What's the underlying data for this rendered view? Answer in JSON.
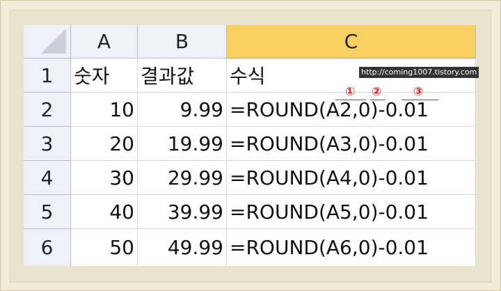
{
  "columns": [
    "A",
    "B",
    "C"
  ],
  "row_numbers": [
    "1",
    "2",
    "3",
    "4",
    "5",
    "6"
  ],
  "rows": [
    {
      "a": "숫자",
      "b": "결과값",
      "c": "수식"
    },
    {
      "a": "10",
      "b": "9.99",
      "c": "=ROUND(A2,0)-0.01"
    },
    {
      "a": "20",
      "b": "19.99",
      "c": "=ROUND(A3,0)-0.01"
    },
    {
      "a": "30",
      "b": "29.99",
      "c": "=ROUND(A4,0)-0.01"
    },
    {
      "a": "40",
      "b": "39.99",
      "c": "=ROUND(A5,0)-0.01"
    },
    {
      "a": "50",
      "b": "49.99",
      "c": "=ROUND(A6,0)-0.01"
    }
  ],
  "watermark": "http://coming1007.tistory.com",
  "annotations": [
    "①",
    "②",
    "③"
  ],
  "colors": {
    "selected_column_header": "#f8d060",
    "annotation": "#d8231b"
  }
}
